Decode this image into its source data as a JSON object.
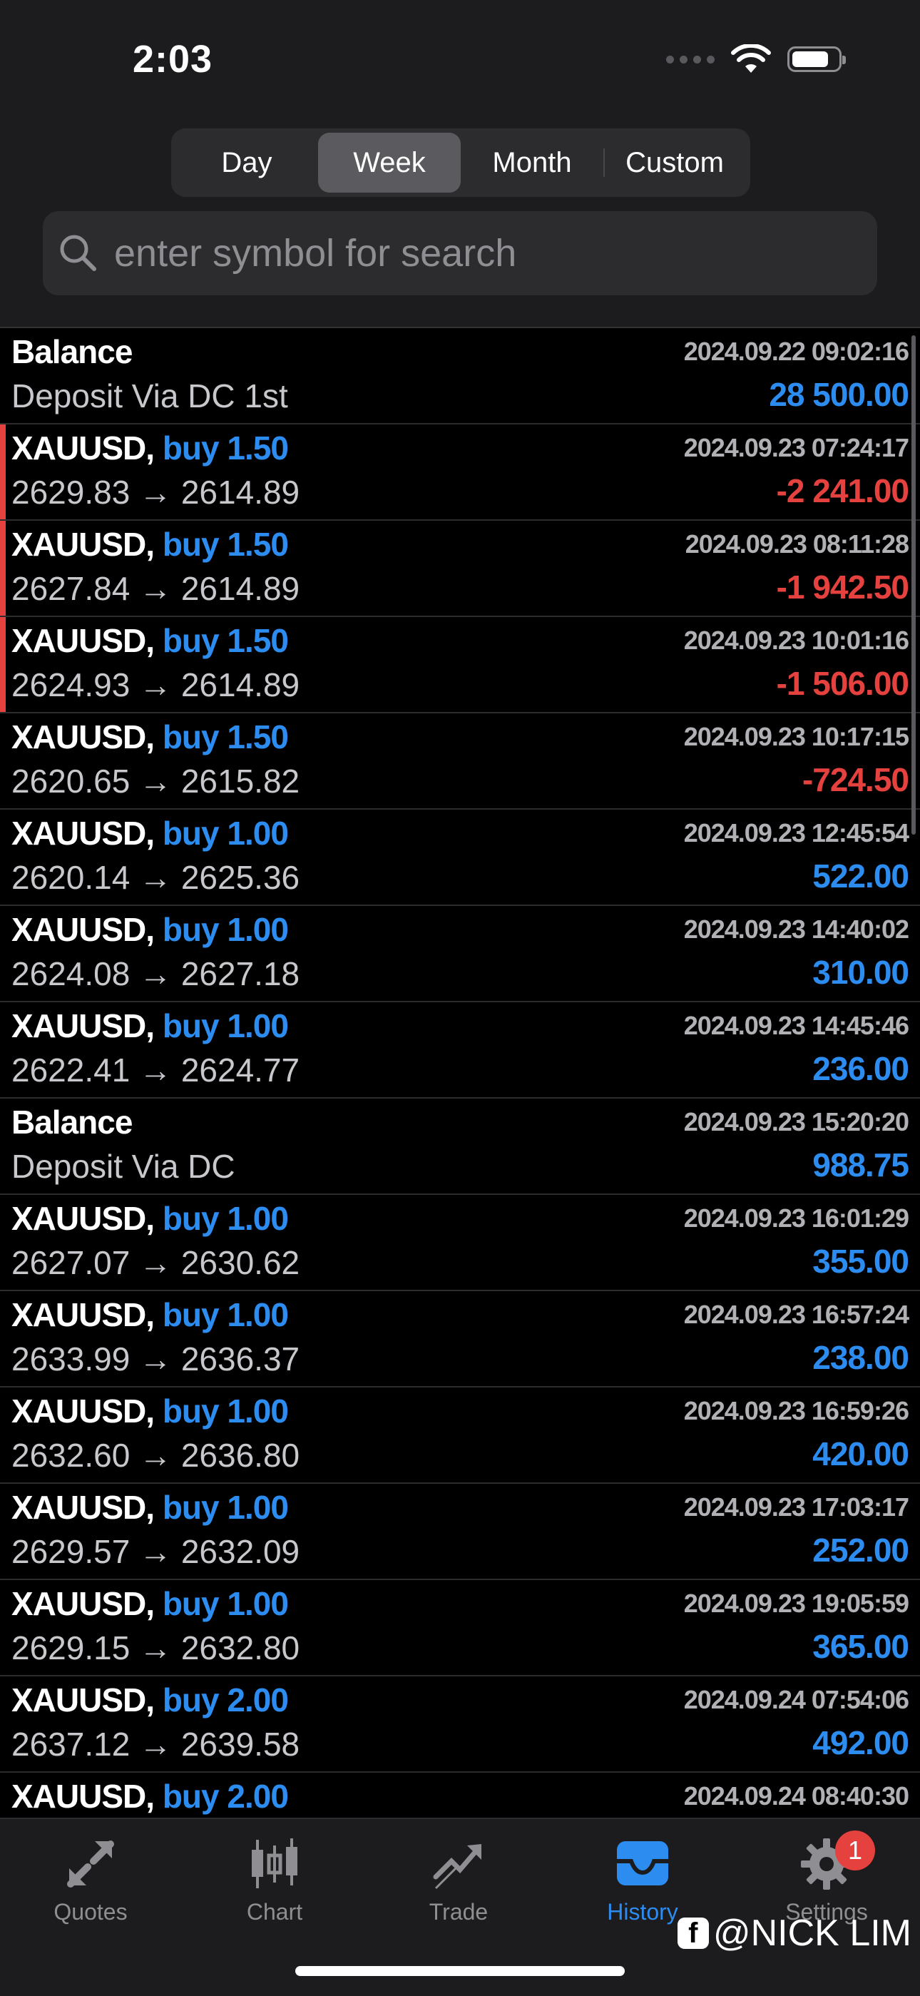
{
  "status": {
    "time": "2:03"
  },
  "period_tabs": [
    {
      "label": "Day",
      "active": false
    },
    {
      "label": "Week",
      "active": true
    },
    {
      "label": "Month",
      "active": false
    },
    {
      "label": "Custom",
      "active": false
    }
  ],
  "search": {
    "placeholder": "enter symbol for search"
  },
  "rows": [
    {
      "kind": "balance",
      "title": "Balance",
      "side": "",
      "detail": "Deposit Via DC 1st",
      "time": "2024.09.22 09:02:16",
      "profit": "28 500.00",
      "sign": "pos",
      "loss_marker": false
    },
    {
      "kind": "trade",
      "title": "XAUUSD,",
      "side": "buy 1.50",
      "detail": "2629.83 → 2614.89",
      "time": "2024.09.23 07:24:17",
      "profit": "-2 241.00",
      "sign": "neg",
      "loss_marker": true
    },
    {
      "kind": "trade",
      "title": "XAUUSD,",
      "side": "buy 1.50",
      "detail": "2627.84 → 2614.89",
      "time": "2024.09.23 08:11:28",
      "profit": "-1 942.50",
      "sign": "neg",
      "loss_marker": true
    },
    {
      "kind": "trade",
      "title": "XAUUSD,",
      "side": "buy 1.50",
      "detail": "2624.93 → 2614.89",
      "time": "2024.09.23 10:01:16",
      "profit": "-1 506.00",
      "sign": "neg",
      "loss_marker": true
    },
    {
      "kind": "trade",
      "title": "XAUUSD,",
      "side": "buy 1.50",
      "detail": "2620.65 → 2615.82",
      "time": "2024.09.23 10:17:15",
      "profit": "-724.50",
      "sign": "neg",
      "loss_marker": false
    },
    {
      "kind": "trade",
      "title": "XAUUSD,",
      "side": "buy 1.00",
      "detail": "2620.14 → 2625.36",
      "time": "2024.09.23 12:45:54",
      "profit": "522.00",
      "sign": "pos",
      "loss_marker": false
    },
    {
      "kind": "trade",
      "title": "XAUUSD,",
      "side": "buy 1.00",
      "detail": "2624.08 → 2627.18",
      "time": "2024.09.23 14:40:02",
      "profit": "310.00",
      "sign": "pos",
      "loss_marker": false
    },
    {
      "kind": "trade",
      "title": "XAUUSD,",
      "side": "buy 1.00",
      "detail": "2622.41 → 2624.77",
      "time": "2024.09.23 14:45:46",
      "profit": "236.00",
      "sign": "pos",
      "loss_marker": false
    },
    {
      "kind": "balance",
      "title": "Balance",
      "side": "",
      "detail": "Deposit Via DC",
      "time": "2024.09.23 15:20:20",
      "profit": "988.75",
      "sign": "pos",
      "loss_marker": false
    },
    {
      "kind": "trade",
      "title": "XAUUSD,",
      "side": "buy 1.00",
      "detail": "2627.07 → 2630.62",
      "time": "2024.09.23 16:01:29",
      "profit": "355.00",
      "sign": "pos",
      "loss_marker": false
    },
    {
      "kind": "trade",
      "title": "XAUUSD,",
      "side": "buy 1.00",
      "detail": "2633.99 → 2636.37",
      "time": "2024.09.23 16:57:24",
      "profit": "238.00",
      "sign": "pos",
      "loss_marker": false
    },
    {
      "kind": "trade",
      "title": "XAUUSD,",
      "side": "buy 1.00",
      "detail": "2632.60 → 2636.80",
      "time": "2024.09.23 16:59:26",
      "profit": "420.00",
      "sign": "pos",
      "loss_marker": false
    },
    {
      "kind": "trade",
      "title": "XAUUSD,",
      "side": "buy 1.00",
      "detail": "2629.57 → 2632.09",
      "time": "2024.09.23 17:03:17",
      "profit": "252.00",
      "sign": "pos",
      "loss_marker": false
    },
    {
      "kind": "trade",
      "title": "XAUUSD,",
      "side": "buy 1.00",
      "detail": "2629.15 → 2632.80",
      "time": "2024.09.23 19:05:59",
      "profit": "365.00",
      "sign": "pos",
      "loss_marker": false
    },
    {
      "kind": "trade",
      "title": "XAUUSD,",
      "side": "buy 2.00",
      "detail": "2637.12 → 2639.58",
      "time": "2024.09.24 07:54:06",
      "profit": "492.00",
      "sign": "pos",
      "loss_marker": false
    },
    {
      "kind": "trade",
      "title": "XAUUSD,",
      "side": "buy 2.00",
      "detail": "",
      "time": "2024.09.24 08:40:30",
      "profit": "",
      "sign": "pos",
      "loss_marker": false
    }
  ],
  "tabbar": [
    {
      "label": "Quotes",
      "icon": "quotes-arrows-icon",
      "active": false
    },
    {
      "label": "Chart",
      "icon": "candlestick-chart-icon",
      "active": false
    },
    {
      "label": "Trade",
      "icon": "trade-trend-icon",
      "active": false
    },
    {
      "label": "History",
      "icon": "history-inbox-icon",
      "active": true
    },
    {
      "label": "Settings",
      "icon": "gear-icon",
      "active": false,
      "badge": "1"
    }
  ],
  "watermark": "@NICK LIM",
  "colors": {
    "accent": "#2d8cf0",
    "loss": "#e5413f",
    "bg": "#000000",
    "panel": "#1c1c1e"
  }
}
